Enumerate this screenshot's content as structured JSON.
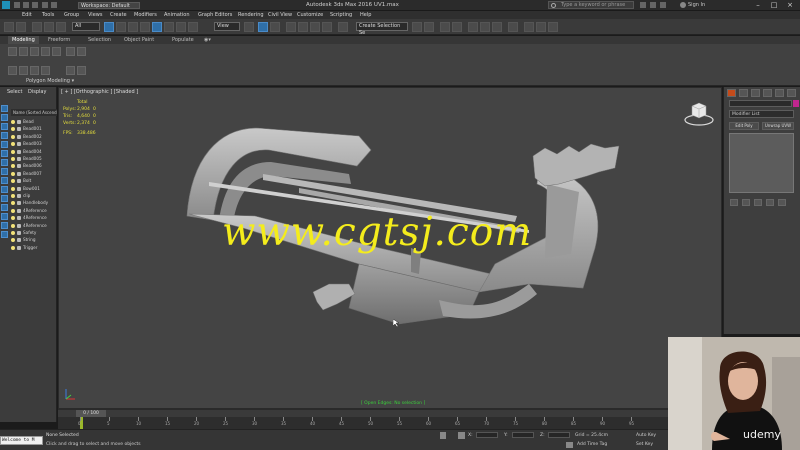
{
  "titlebar": {
    "workspace": "Workspace: Default",
    "app_title": "Autodesk 3ds Max 2016    UV1.max",
    "search_placeholder": "Type a keyword or phrase",
    "sign_in": "Sign In"
  },
  "menu": [
    "Edit",
    "Tools",
    "Group",
    "Views",
    "Create",
    "Modifiers",
    "Animation",
    "Graph Editors",
    "Rendering",
    "Civil View",
    "Customize",
    "Scripting",
    "Help"
  ],
  "toolbar": {
    "filter": "All",
    "ref_coord": "View",
    "selection_set": "Create Selection Se"
  },
  "ribbon": {
    "tabs": [
      "Modeling",
      "Freeform",
      "Selection",
      "Object Paint",
      "Populate"
    ],
    "panel_label": "Polygon Modeling ▾"
  },
  "explorer": {
    "tabs": [
      "Select",
      "Display"
    ],
    "header": "Name (Sorted Ascending)",
    "objects": [
      "Bead",
      "Bead001",
      "Bead002",
      "Bead003",
      "Bead004",
      "Bead005",
      "Bead006",
      "Bead007",
      "Bolt",
      "Bow001",
      "clip",
      "Handlebody",
      "4Reference",
      "4Reference",
      "4Reference",
      "Safety",
      "String",
      "Trigger"
    ]
  },
  "viewport": {
    "label": "[ + ] [Orthographic ] [Shaded ]",
    "stats": {
      "total_label": "Total",
      "rows": [
        {
          "k": "Polys:",
          "v1": "2,904",
          "v2": "0"
        },
        {
          "k": "Tris:",
          "v1": "4,640",
          "v2": "0"
        },
        {
          "k": "Verts:",
          "v1": "2,374",
          "v2": "0"
        }
      ],
      "fps_label": "FPS:",
      "fps_value": "338.486"
    },
    "watermark": "www.cgtsj.com",
    "status": "[ Open Edges: No selection ]"
  },
  "command_panel": {
    "modifier_list": "Modifier List",
    "button1": "Edit Poly",
    "button2": "Unwrap UVW"
  },
  "timeline": {
    "range": "0 / 100",
    "ticks": [
      "0",
      "5",
      "10",
      "15",
      "20",
      "25",
      "30",
      "35",
      "40",
      "45",
      "50",
      "55",
      "60",
      "65",
      "70",
      "75",
      "80",
      "85",
      "90",
      "95"
    ]
  },
  "status": {
    "selection": "None Selected",
    "prompt": "Click and drag to select and move objects",
    "maxscript": "Welcome to M",
    "x_label": "X:",
    "y_label": "Y:",
    "z_label": "Z:",
    "grid": "Grid = 25.4cm",
    "add_time_tag": "Add Time Tag",
    "auto_key": "Auto Key",
    "set_key": "Set Key"
  },
  "webcam": {
    "brand": "udemy"
  },
  "colors": {
    "stats_yellow": "#e6df3c",
    "watermark_yellow": "#f4ec1c",
    "viewport_bg": "#444444",
    "status_green": "#3bd13b",
    "accent_blue": "#2f6fa8"
  }
}
